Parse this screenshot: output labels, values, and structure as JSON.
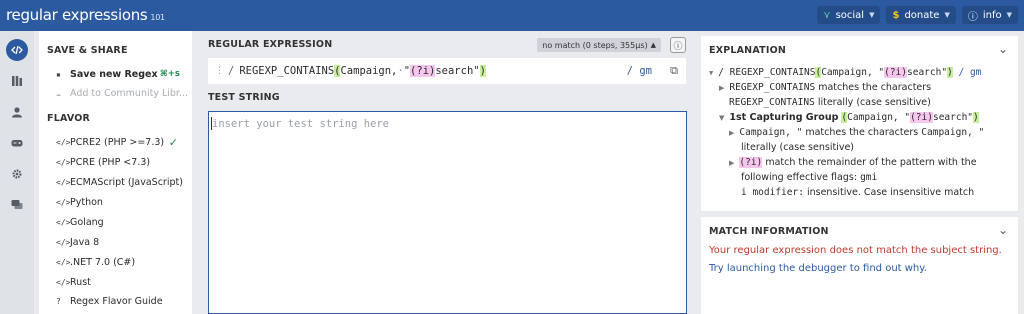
{
  "header": {
    "logo": "regular expressions",
    "logo_sub": "101",
    "nav": [
      {
        "label": "social",
        "icon": "social-icon"
      },
      {
        "label": "donate",
        "icon": "dollar-icon"
      },
      {
        "label": "info",
        "icon": "info-icon"
      }
    ]
  },
  "rail": [
    "code-icon",
    "library-icon",
    "user-icon",
    "quiz-icon",
    "settings-icon",
    "chat-icon"
  ],
  "left": {
    "save_share_title": "SAVE & SHARE",
    "save_label": "Save new Regex",
    "save_shortcut": "⌘+s",
    "community_label": "Add to Community Libr...",
    "flavor_title": "FLAVOR",
    "flavors": [
      "PCRE2 (PHP >=7.3)",
      "PCRE (PHP <7.3)",
      "ECMAScript (JavaScript)",
      "Python",
      "Golang",
      "Java 8",
      ".NET 7.0 (C#)",
      "Rust"
    ],
    "guide_label": "Regex Flavor Guide"
  },
  "center": {
    "regex_title": "REGULAR EXPRESSION",
    "match_status": "no match (0 steps, 355µs)",
    "delimiter": "/",
    "regex_prefix": "REGEXP_CONTAINS",
    "regex_open": "(",
    "regex_arg": "Campaign,",
    "regex_quote": "\"",
    "regex_flag": "(?i)",
    "regex_word": "search",
    "regex_close_quote": "\"",
    "regex_close": ")",
    "flags": "/ gm",
    "test_title": "TEST STRING",
    "test_placeholder": "insert your test string here"
  },
  "explanation": {
    "title": "EXPLANATION",
    "line1_prefix": "/ REGEXP_CONTAINS",
    "line1_open": "(",
    "line1_mid": "Campaign, \"",
    "line1_flag": "(?i)",
    "line1_end": "search\"",
    "line1_close": ")",
    "line1_flags": "/ gm",
    "line2_code": "REGEXP_CONTAINS",
    "line2_text": "matches the characters",
    "line3_code": "REGEXP_CONTAINS",
    "line3_text": "literally (case sensitive)",
    "line4_label": "1st Capturing Group",
    "line4_open": "(",
    "line4_mid": "Campaign, \"",
    "line4_flag": "(?i)",
    "line4_end": "search\"",
    "line4_close": ")",
    "line5_code": "Campaign, \"",
    "line5_text": "matches the characters",
    "line5_code2": "Campaign, \"",
    "line6_text": "literally (case sensitive)",
    "line7_flag": "(?i)",
    "line7_text": "match the remainder of the pattern with the",
    "line8_text": "following effective flags:",
    "line8_code": "gmi",
    "line9_code": "i modifier:",
    "line9_text": "insensitive. Case insensitive match"
  },
  "match_info": {
    "title": "MATCH INFORMATION",
    "error": "Your regular expression does not match the subject string.",
    "debug_link": "Try launching the debugger to find out why."
  }
}
